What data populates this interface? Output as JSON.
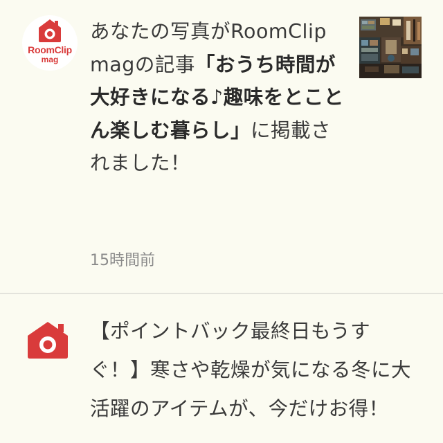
{
  "notifications": [
    {
      "avatar": {
        "brand": "RoomClip",
        "sub": "mag"
      },
      "message_prefix": "あなたの写真がRoomClip magの記事",
      "message_bold": "「おうち時間が大好きになる♪趣味をとことん楽しむ暮らし」",
      "message_suffix": "に掲載されました！",
      "time": "15時間前",
      "thumbnail": "room-photo"
    },
    {
      "avatar": "roomclip-icon",
      "message": "【ポイントバック最終日もうすぐ！】寒さや乾燥が気になる冬に大活躍のアイテムが、今だけお得！"
    }
  ],
  "colors": {
    "background": "#fbfbf1",
    "brand_red": "#d93b3b",
    "text": "#3a3a3a",
    "muted": "#8a8a8a"
  }
}
